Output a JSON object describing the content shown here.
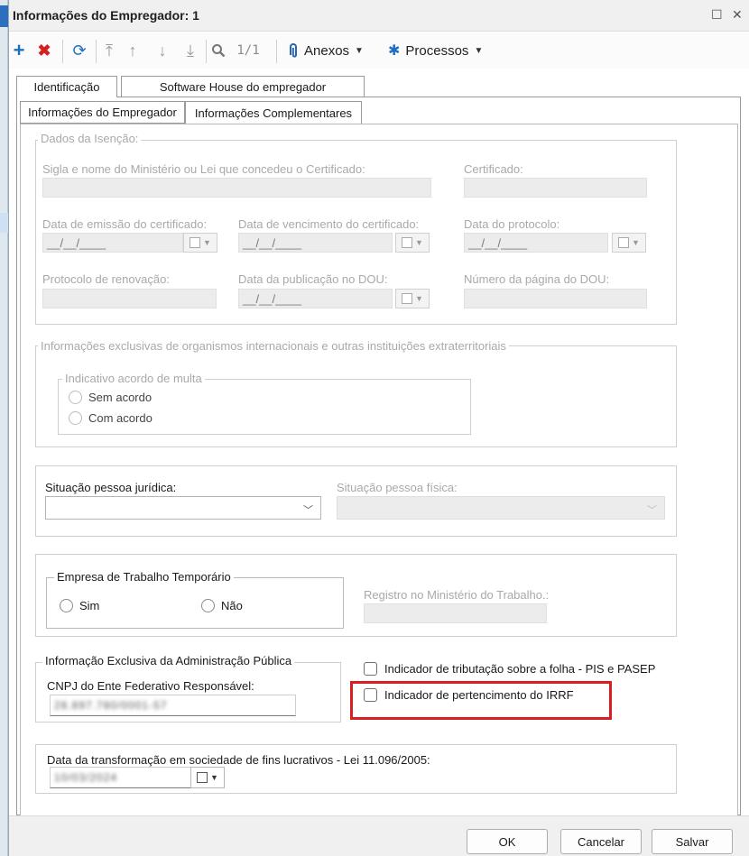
{
  "window": {
    "title": "Informações do Empregador: 1",
    "buttons": {
      "maximize": "☐",
      "close": "✕"
    }
  },
  "toolbar": {
    "record_counter": "1/1",
    "anexos_label": "Anexos",
    "processos_label": "Processos",
    "colors": {
      "add": "#1f6fc0",
      "delete": "#d42020",
      "refresh": "#1f6fc0"
    }
  },
  "tabs": {
    "top": [
      "Identificação",
      "Software House do empregador"
    ],
    "sub": [
      "Informações do Empregador",
      "Informações Complementares"
    ]
  },
  "isencao": {
    "group_label": "Dados da Isenção:",
    "sigla_label": "Sigla e nome do Ministério ou Lei que concedeu o Certificado:",
    "certificado_label": "Certificado:",
    "emissao_label": "Data de emissão do certificado:",
    "vencimento_label": "Data de vencimento do certificado:",
    "protocolo_data_label": "Data do protocolo:",
    "date_placeholder": "__/__/____",
    "renovacao_label": "Protocolo de renovação:",
    "dou_label": "Data da publicação no DOU:",
    "pagina_label": "Número da página do DOU:"
  },
  "organismos": {
    "group_label": "Informações exclusivas de organismos internacionais e outras instituições extraterritoriais",
    "acordo_label": "Indicativo acordo de multa",
    "options": [
      "Sem acordo",
      "Com acordo"
    ]
  },
  "situacao": {
    "pj_label": "Situação pessoa jurídica:",
    "pf_label": "Situação pessoa física:"
  },
  "temporario": {
    "group_label": "Empresa de Trabalho Temporário",
    "options": [
      "Sim",
      "Não"
    ],
    "registro_label": "Registro no Ministério do Trabalho.:"
  },
  "adm_publica": {
    "group_label": "Informação Exclusiva da Administração Pública",
    "cnpj_label": "CNPJ do Ente Federativo Responsável:",
    "cnpj_value": "28.897.780/0001-57"
  },
  "indicadores": {
    "pis_pasep": "Indicador de tributação sobre a folha - PIS e PASEP",
    "irrf": "Indicador de pertencimento do IRRF",
    "highlight_color": "#d81e1e"
  },
  "transformacao": {
    "label": "Data da transformação em sociedade de fins lucrativos - Lei 11.096/2005:",
    "value": "10/03/2024"
  },
  "footer": {
    "ok": "OK",
    "cancel": "Cancelar",
    "save": "Salvar"
  }
}
